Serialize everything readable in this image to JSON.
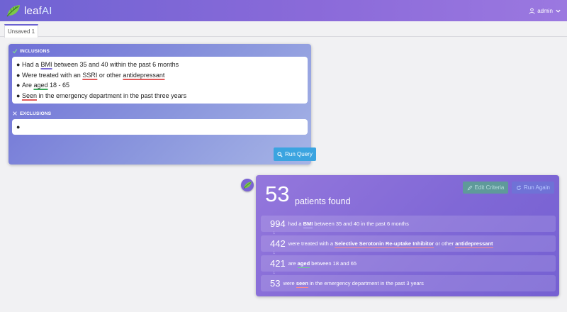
{
  "app": {
    "brand_main": "leaf",
    "brand_ai": "AI",
    "user_label": "admin"
  },
  "tabs": [
    {
      "label": "Unsaved 1"
    }
  ],
  "query": {
    "inclusions_title": "INCLUSIONS",
    "inclusions": [
      {
        "pre": "Had a ",
        "term": "BMI",
        "post": " between 35 and 40 within the past 6 months"
      },
      {
        "pre": "Were treated with an ",
        "term": "SSRI",
        "mid": " or other ",
        "term2": "antidepressant"
      },
      {
        "pre": "Are ",
        "term": "aged",
        "post": " 18 - 65"
      },
      {
        "term": "Seen",
        "post": " in the emergency department in the past three years"
      }
    ],
    "exclusions_title": "EXCLUSIONS",
    "exclusions": [
      ""
    ],
    "run_label": "Run Query"
  },
  "results": {
    "count": "53",
    "found_label": "patients found",
    "edit_label": "Edit Criteria",
    "run_again_label": "Run Again",
    "steps": [
      {
        "count": "994",
        "a": "had a ",
        "term": "BMI",
        "b": " between 35 and 40 in the past 6 months"
      },
      {
        "count": "442",
        "a": "were treated with a ",
        "term": "Selective Serotonin Re-uptake Inhibitor",
        "b": " or other ",
        "term2": "antidepressant"
      },
      {
        "count": "421",
        "a": "are ",
        "term": "aged",
        "b": " between 18 and 65"
      },
      {
        "count": "53",
        "a": "were ",
        "term": "seen",
        "b": " in the emergency department in the past 3 years"
      }
    ]
  },
  "colors": {
    "accent": "#6f63d3",
    "run_button": "#3ba4e0"
  },
  "icons": [
    "leaf-logo-icon",
    "user-icon",
    "chevron-down-icon",
    "check-icon",
    "close-icon",
    "search-icon",
    "pencil-icon",
    "refresh-icon",
    "arrow-down-icon"
  ]
}
